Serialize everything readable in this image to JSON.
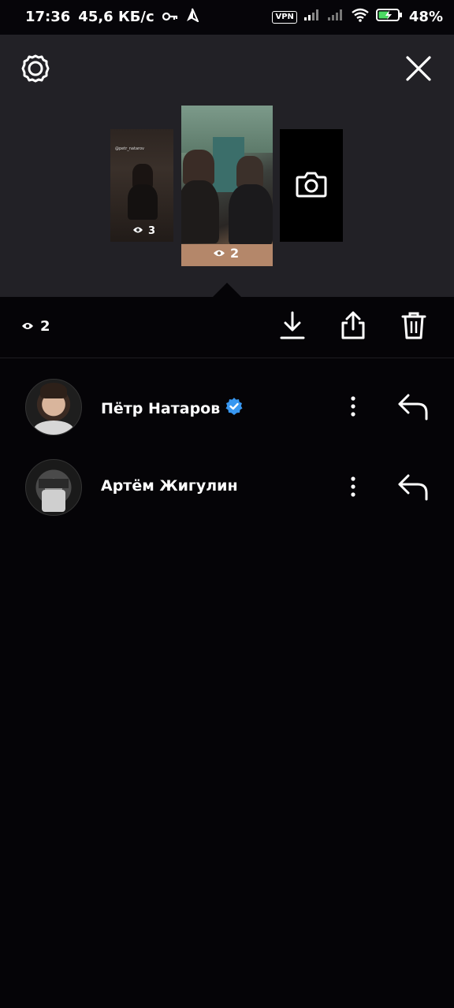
{
  "status_bar": {
    "time": "17:36",
    "speed": "45,6 КБ/с",
    "vpn": "VPN",
    "battery": "48%"
  },
  "stories": [
    {
      "views": "3",
      "handle": "@petr_natarov"
    },
    {
      "views": "2"
    }
  ],
  "current_views": "2",
  "viewers": [
    {
      "name": "Пётр Натаров",
      "verified": true
    },
    {
      "name": "Артём Жигулин",
      "verified": false
    }
  ],
  "colors": {
    "panel": "#222126",
    "background": "#050407",
    "verified": "#3897f0"
  }
}
